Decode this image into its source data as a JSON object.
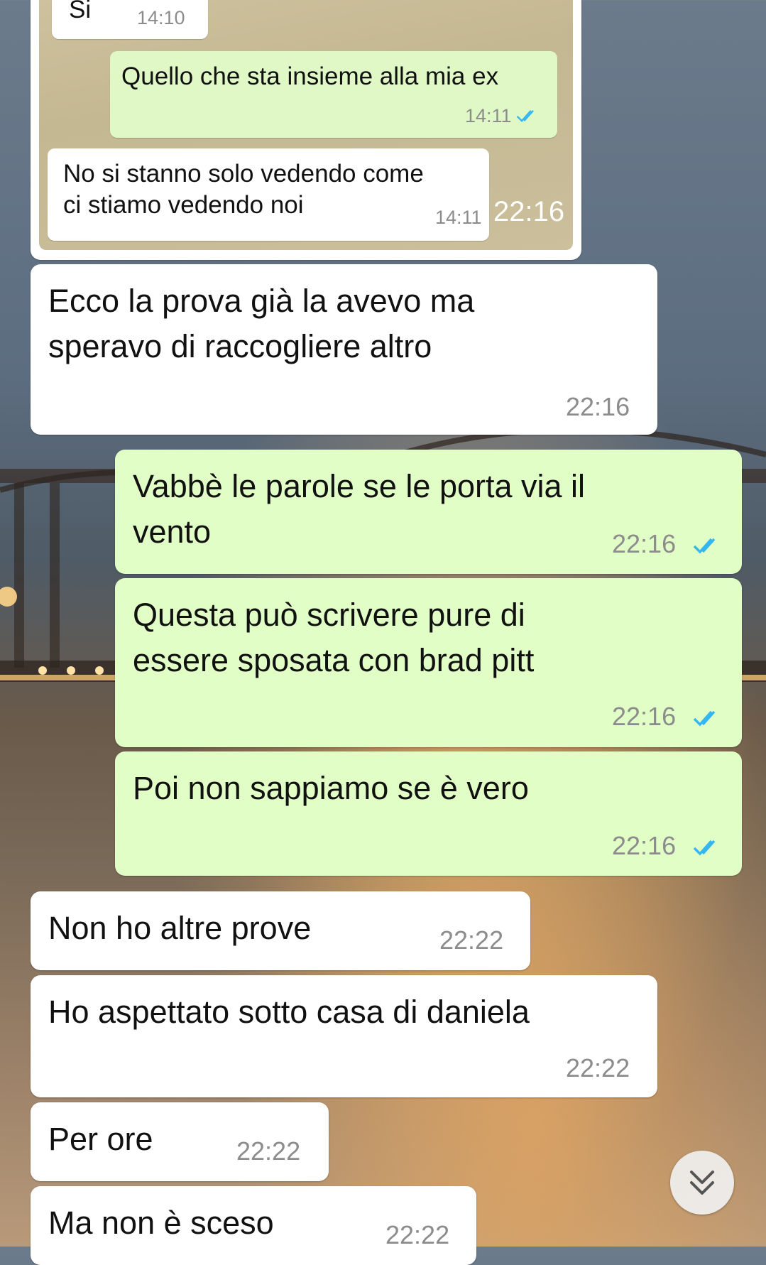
{
  "quoted": {
    "msg1": {
      "text": "Si",
      "time": "14:10"
    },
    "msg2": {
      "text": "Quello che sta insieme alla mia ex",
      "time": "14:11"
    },
    "msg3": {
      "line1": "No si stanno solo vedendo come",
      "line2": "ci stiamo vedendo noi",
      "time": "14:11"
    },
    "outer_time": "22:16"
  },
  "messages": [
    {
      "id": "m1",
      "line1": "Ecco la prova già la avevo ma",
      "line2": "speravo di raccogliere altro",
      "time": "22:16"
    },
    {
      "id": "m2",
      "line1": "Vabbè le parole se le porta via il",
      "line2": "vento",
      "time": "22:16"
    },
    {
      "id": "m3",
      "line1": "Questa può scrivere pure di",
      "line2": "essere sposata con brad pitt",
      "time": "22:16"
    },
    {
      "id": "m4",
      "line1": "Poi non sappiamo se è vero",
      "time": "22:16"
    },
    {
      "id": "m5",
      "line1": "Non ho altre prove",
      "time": "22:22"
    },
    {
      "id": "m6",
      "line1": "Ho aspettato sotto casa di daniela",
      "time": "22:22"
    },
    {
      "id": "m7",
      "line1": "Per ore",
      "time": "22:22"
    },
    {
      "id": "m8",
      "line1": "Ma non è sceso",
      "time": "22:22"
    }
  ],
  "icons": {
    "read_ticks": "double-check-icon",
    "scroll": "chevron-down-double-icon"
  },
  "colors": {
    "incoming": "#ffffff",
    "outgoing": "#e1fec6",
    "tick": "#34b7f1",
    "time": "#8c8c8c"
  }
}
